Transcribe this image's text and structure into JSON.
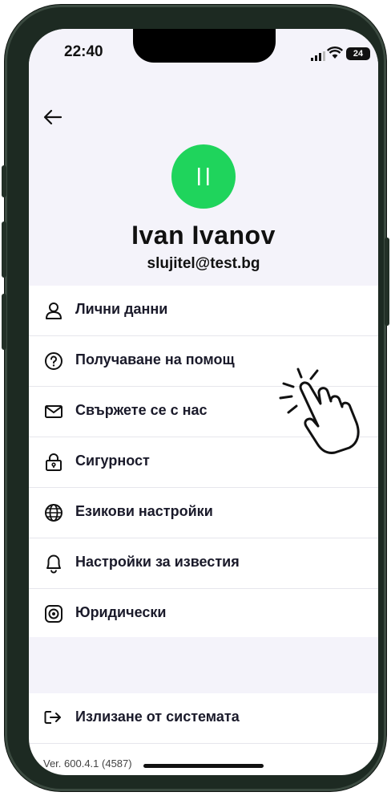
{
  "status_bar": {
    "time": "22:40",
    "battery": "24"
  },
  "profile": {
    "avatar_initials": "II",
    "name": "Ivan Ivanov",
    "email": "slujitel@test.bg",
    "avatar_color": "#1fd45c"
  },
  "menu": {
    "items": [
      {
        "label": "Лични данни",
        "icon": "user-icon"
      },
      {
        "label": "Получаване на помощ",
        "icon": "help-circle-icon"
      },
      {
        "label": "Свържете се с нас",
        "icon": "mail-icon"
      },
      {
        "label": "Сигурност",
        "icon": "lock-icon"
      },
      {
        "label": "Езикови настройки",
        "icon": "globe-icon"
      },
      {
        "label": "Настройки за известия",
        "icon": "bell-icon"
      },
      {
        "label": "Юридически",
        "icon": "shield-icon"
      }
    ]
  },
  "logout": {
    "label": "Излизане от системата",
    "icon": "logout-icon"
  },
  "version": "Ver. 600.4.1 (4587)"
}
